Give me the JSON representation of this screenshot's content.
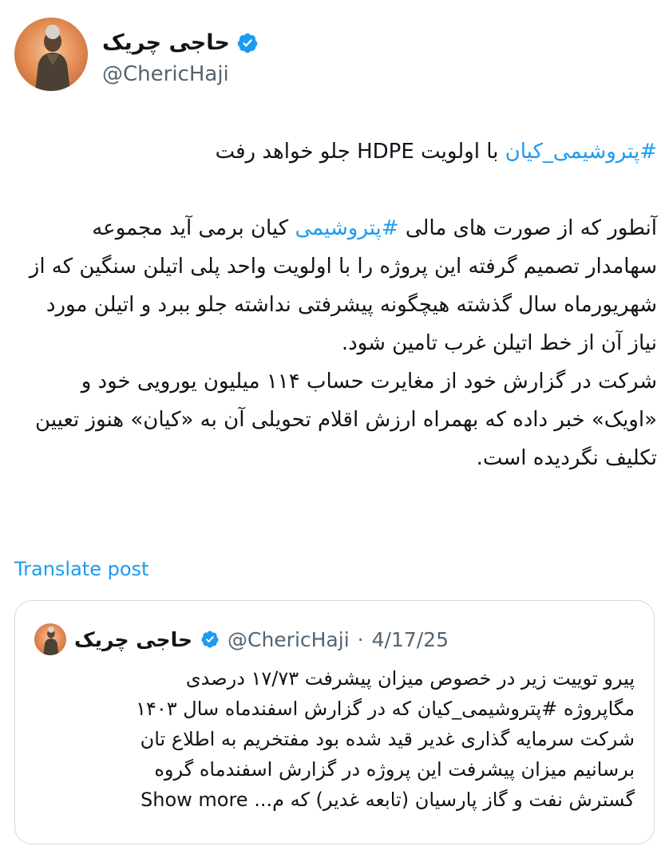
{
  "author": {
    "name": "حاجی چریک",
    "handle": "@ChericHaji",
    "verified": true,
    "verified_color": "#1d9bf0"
  },
  "tweet": {
    "line1_hashtag": "#پتروشیمی_کیان",
    "line1_text": " با اولویت HDPE جلو خواهد رفت",
    "p2_a": "آنطور که از صورت های مالی ",
    "p2_hashtag": "#پتروشیمی",
    "p2_b": " کیان برمی آید مجموعه سهامدار تصمیم گرفته این پروژه را با اولویت واحد پلی اتیلن سنگین که از شهریورماه سال گذشته هیچگونه پیشرفتی نداشته جلو ببرد و اتیلن مورد نیاز آن از خط اتیلن غرب تامین شود.",
    "p3": "شرکت در گزارش خود از مغایرت حساب ۱۱۴ میلیون یورویی خود و «اویک» خبر داده که بهمراه ارزش اقلام تحویلی آن به «کیان» هنوز تعیین تکلیف نگردیده است."
  },
  "translate_label": "Translate post",
  "quote": {
    "name": "حاجی چریک",
    "handle": "@ChericHaji",
    "dot": "·",
    "date": "4/17/25",
    "lines": [
      "پیرو توییت زیر در خصوص میزان پیشرفت ۱۷/۷۳ درصدی",
      "مگاپروژه #پتروشیمی_کیان که در گزارش اسفندماه سال ۱۴۰۳",
      "شرکت سرمایه گذاری غدیر قید شده بود مفتخریم به اطلاع تان",
      "برسانیم میزان پیشرفت این پروژه در گزارش اسفندماه گروه"
    ],
    "last_line": "گسترش نفت و گاز پارسیان (تابعه غدیر) که م...",
    "show_more": "Show more"
  },
  "colors": {
    "link": "#1d9bf0",
    "secondary_text": "#536471",
    "border": "#cfd9de"
  }
}
